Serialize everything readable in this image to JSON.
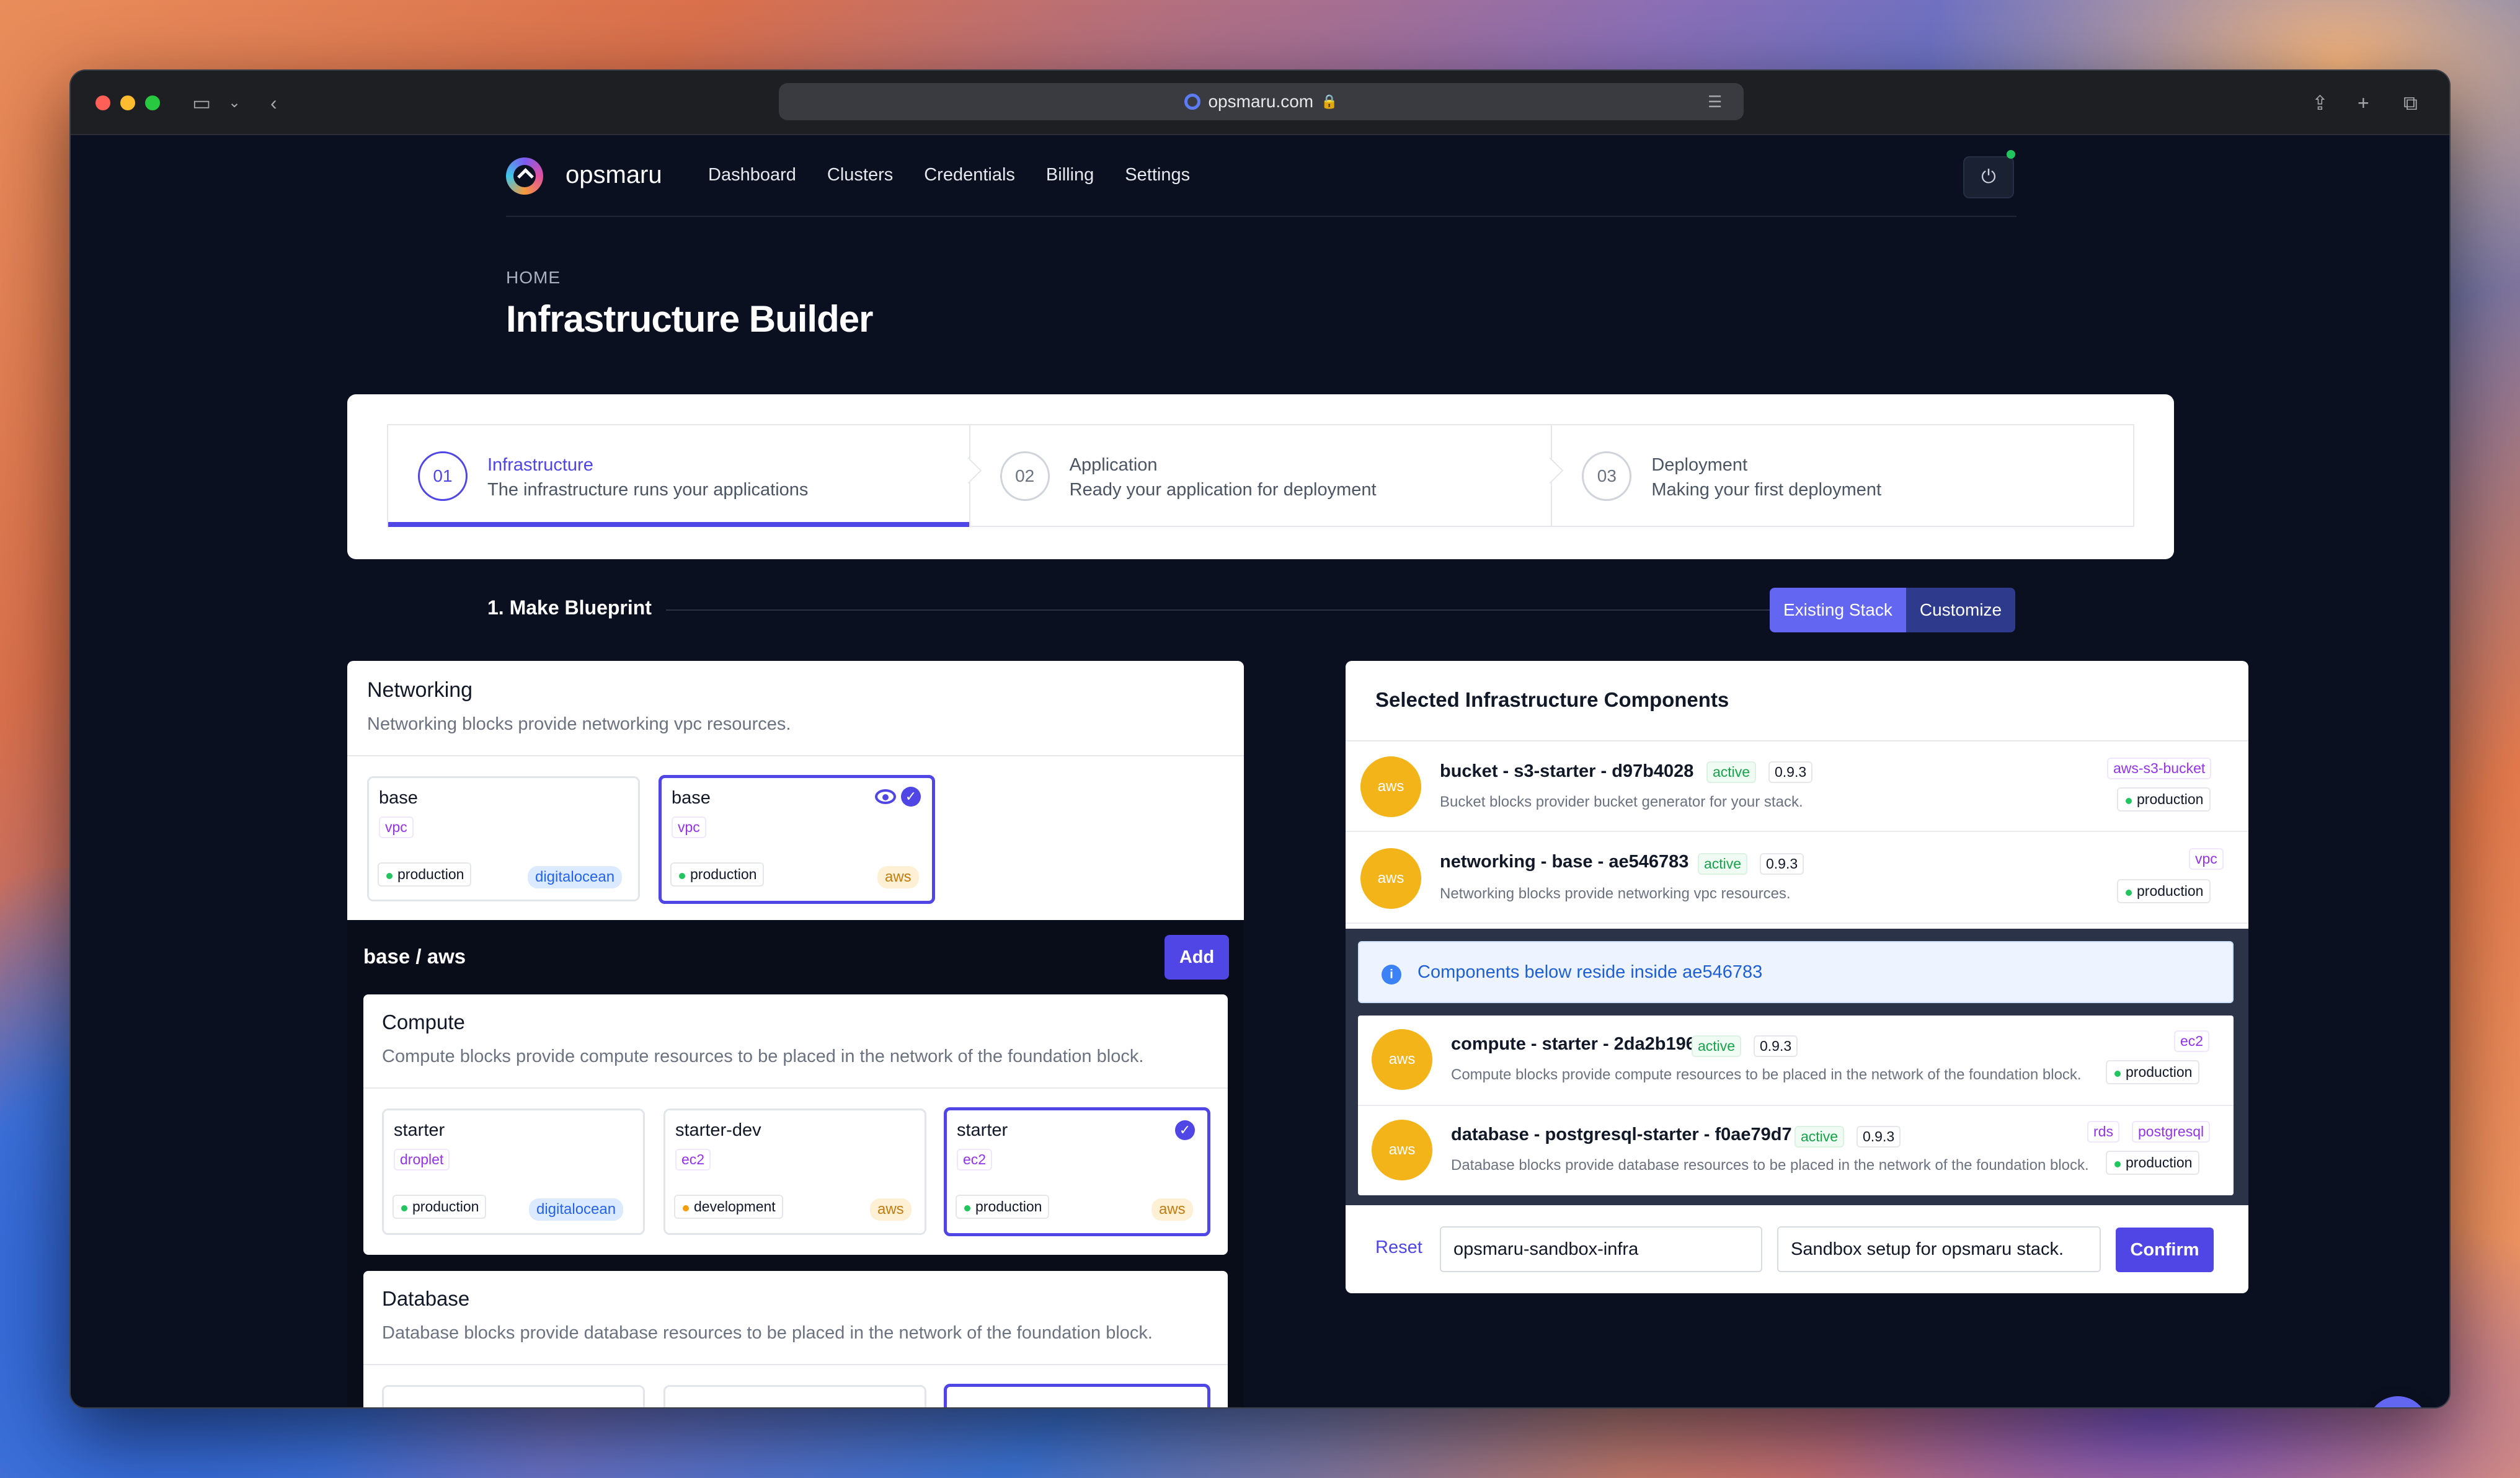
{
  "browser": {
    "url": "opsmaru.com"
  },
  "nav": {
    "brand": "opsmaru",
    "links": [
      "Dashboard",
      "Clusters",
      "Credentials",
      "Billing",
      "Settings"
    ]
  },
  "page": {
    "breadcrumb": "HOME",
    "title": "Infrastructure Builder"
  },
  "steps": [
    {
      "num": "01",
      "title": "Infrastructure",
      "sub": "The infrastructure runs your applications",
      "active": true
    },
    {
      "num": "02",
      "title": "Application",
      "sub": "Ready your application for deployment",
      "active": false
    },
    {
      "num": "03",
      "title": "Deployment",
      "sub": "Making your first deployment",
      "active": false
    }
  ],
  "blueprint": {
    "title": "1. Make Blueprint",
    "mode_existing": "Existing Stack",
    "mode_customize": "Customize"
  },
  "networking": {
    "title": "Networking",
    "desc": "Networking blocks provide networking vpc resources.",
    "cards": [
      {
        "name": "base",
        "tag": "vpc",
        "env": "production",
        "provider": "digitalocean"
      },
      {
        "name": "base",
        "tag": "vpc",
        "env": "production",
        "provider": "aws"
      }
    ]
  },
  "selection": {
    "title": "base / aws",
    "add_label": "Add"
  },
  "compute": {
    "title": "Compute",
    "desc": "Compute blocks provide compute resources to be placed in the network of the foundation block.",
    "cards": [
      {
        "name": "starter",
        "tag": "droplet",
        "env": "production",
        "provider": "digitalocean"
      },
      {
        "name": "starter-dev",
        "tag": "ec2",
        "env": "development",
        "provider": "aws"
      },
      {
        "name": "starter",
        "tag": "ec2",
        "env": "production",
        "provider": "aws"
      }
    ]
  },
  "database": {
    "title": "Database",
    "desc": "Database blocks provide database resources to be placed in the network of the foundation block."
  },
  "selected": {
    "title": "Selected Infrastructure Components",
    "top": [
      {
        "avatar": "aws",
        "title": "bucket - s3-starter - d97b4028",
        "status": "active",
        "version": "0.9.3",
        "desc": "Bucket blocks provider bucket generator for your stack.",
        "tags": [
          "aws-s3-bucket"
        ],
        "env": "production"
      },
      {
        "avatar": "aws",
        "title": "networking - base - ae546783",
        "status": "active",
        "version": "0.9.3",
        "desc": "Networking blocks provide networking vpc resources.",
        "tags": [
          "vpc"
        ],
        "env": "production"
      }
    ],
    "info": "Components below reside inside ae546783",
    "nested": [
      {
        "avatar": "aws",
        "title": "compute - starter - 2da2b196",
        "status": "active",
        "version": "0.9.3",
        "desc": "Compute blocks provide compute resources to be placed in the network of the foundation block.",
        "tags": [
          "ec2"
        ],
        "env": "production"
      },
      {
        "avatar": "aws",
        "title": "database - postgresql-starter - f0ae79d7",
        "status": "active",
        "version": "0.9.3",
        "desc": "Database blocks provide database resources to be placed in the network of the foundation block.",
        "tags": [
          "rds",
          "postgresql"
        ],
        "env": "production"
      }
    ],
    "reset_label": "Reset",
    "name_value": "opsmaru-sandbox-infra",
    "desc_value": "Sandbox setup for opsmaru stack.",
    "confirm_label": "Confirm"
  }
}
